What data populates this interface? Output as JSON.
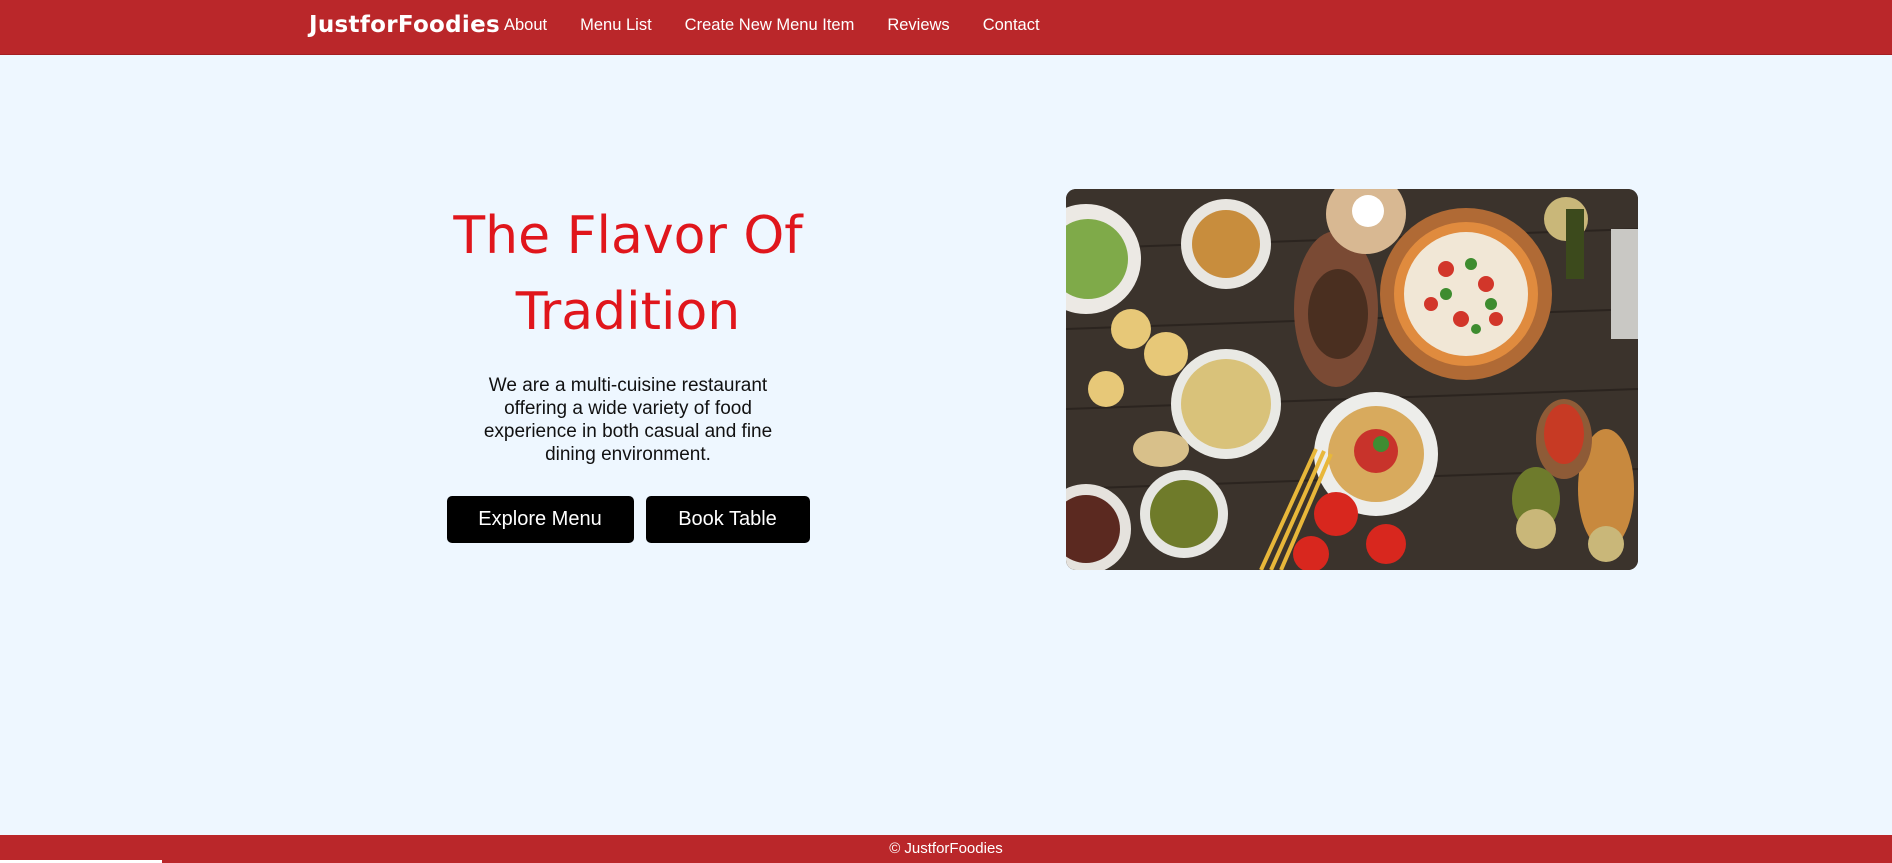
{
  "navbar": {
    "brand": "JustforFoodies",
    "links": [
      "About",
      "Menu List",
      "Create New Menu Item",
      "Reviews",
      "Contact"
    ]
  },
  "hero": {
    "title_line1": "The Flavor Of",
    "title_line2": "Tradition",
    "description": "We are a multi-cuisine restaurant offering a wide variety of food experience in both casual and fine dining environment.",
    "buttons": {
      "explore": "Explore Menu",
      "book": "Book Table"
    },
    "image_alt": "Assorted dishes on a wooden table"
  },
  "footer": {
    "text": "© JustforFoodies"
  },
  "colors": {
    "primary": "#ba272a",
    "title": "#e0161c",
    "background": "#eef7ff",
    "button": "#000000"
  }
}
